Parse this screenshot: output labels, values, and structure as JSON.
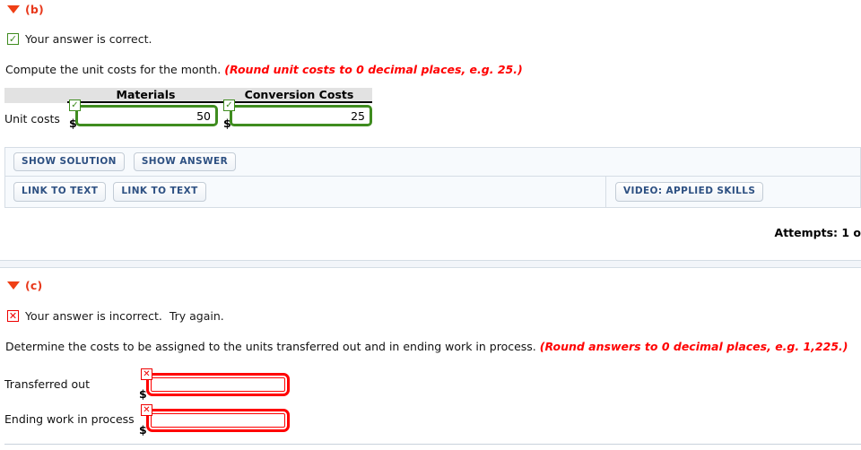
{
  "part_b": {
    "section_label": "(b)",
    "status": {
      "icon": "check-icon",
      "glyph": "✓",
      "text": "Your answer is correct."
    },
    "prompt": "Compute the unit costs for the month.",
    "prompt_hint": "(Round unit costs to 0 decimal places, e.g. 25.)",
    "table": {
      "columns": [
        "Materials",
        "Conversion Costs"
      ],
      "row_label": "Unit costs",
      "currency": "$",
      "values": [
        "50",
        "25"
      ],
      "marks": [
        "✓",
        "✓"
      ]
    },
    "toolbar": {
      "row1": [
        "SHOW SOLUTION",
        "SHOW ANSWER"
      ],
      "row2_left": [
        "LINK TO TEXT",
        "LINK TO TEXT"
      ],
      "row2_right": [
        "VIDEO: APPLIED SKILLS"
      ]
    },
    "attempts": "Attempts: 1 o"
  },
  "part_c": {
    "section_label": "(c)",
    "status": {
      "icon": "x-icon",
      "glyph": "✕",
      "text": "Your answer is incorrect.  Try again."
    },
    "prompt": "Determine the costs to be assigned to the units transferred out and in ending work in process.",
    "prompt_hint": "(Round answers to 0 decimal places, e.g. 1,225.)",
    "rows": [
      {
        "label": "Transferred out",
        "currency": "$",
        "value": "",
        "mark": "✕"
      },
      {
        "label": "Ending work in process",
        "currency": "$",
        "value": "",
        "mark": "✕"
      }
    ]
  },
  "colors": {
    "accent_red": "#e8381b",
    "hint_red": "#ff0000",
    "correct_green": "#3f8c1f",
    "incorrect_red": "#ff0000",
    "button_text": "#2d5082"
  }
}
